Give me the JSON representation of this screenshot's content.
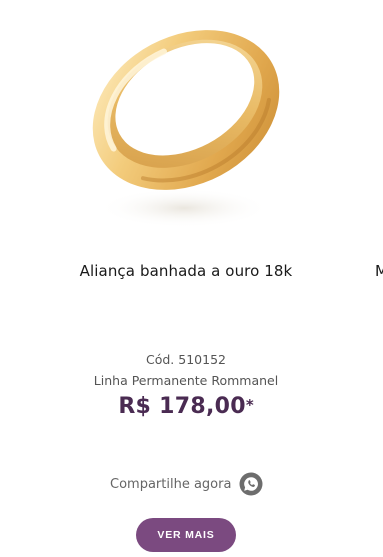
{
  "product": {
    "title": "Aliança banhada a ouro 18k",
    "code": "Cód. 510152",
    "line": "Linha Permanente Rommanel",
    "price": "R$ 178,00",
    "price_asterisk": "*",
    "image_alt": "Aliança banhada a ouro 18k"
  },
  "share": {
    "label": "Compartilhe agora",
    "icon": "whatsapp-icon"
  },
  "cta": {
    "label": "VER MAIS"
  },
  "next_card": {
    "title_peek": "M"
  },
  "colors": {
    "price": "#4a2b52",
    "button_bg": "#7b4a80",
    "button_text": "#ffffff",
    "gold": "#e8b45a"
  }
}
